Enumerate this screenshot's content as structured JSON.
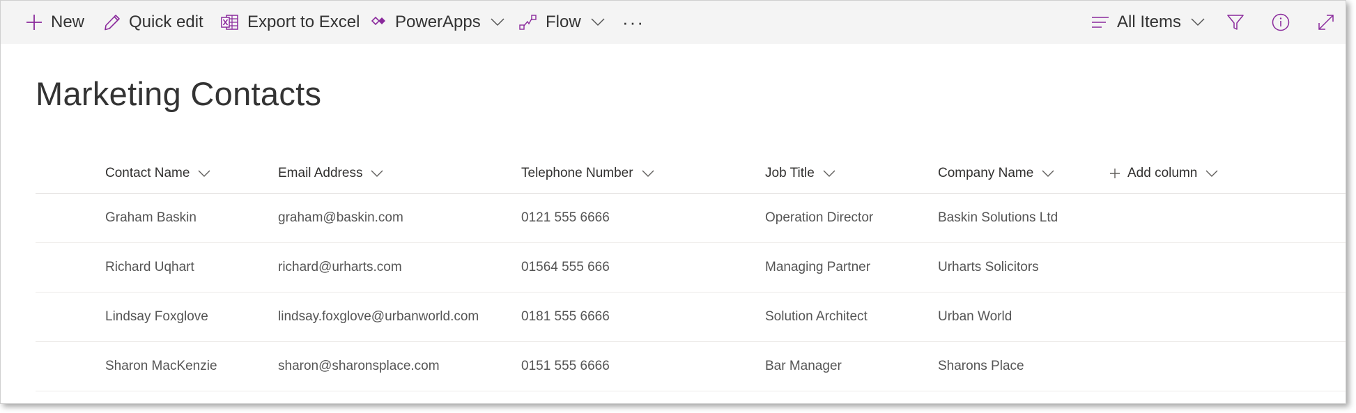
{
  "colors": {
    "accent": "#8a2a9c",
    "toolbar_bg": "#f4f4f4",
    "text": "#333333",
    "cell_text": "#555555",
    "divider": "#edebe9"
  },
  "toolbar": {
    "new_label": "New",
    "new_icon": "plus-icon",
    "quick_edit_label": "Quick edit",
    "quick_edit_icon": "pencil-icon",
    "export_label": "Export to Excel",
    "export_icon": "excel-icon",
    "powerapps_label": "PowerApps",
    "powerapps_icon": "powerapps-icon",
    "flow_label": "Flow",
    "flow_icon": "flow-icon",
    "more_label": "···",
    "view_label": "All Items",
    "view_icon": "view-lines-icon",
    "filter_icon": "filter-icon",
    "info_icon": "info-icon",
    "expand_icon": "expand-icon"
  },
  "list": {
    "title": "Marketing Contacts",
    "columns": [
      "Contact Name",
      "Email Address",
      "Telephone Number",
      "Job Title",
      "Company Name"
    ],
    "add_column_label": "Add column",
    "rows": [
      [
        "Graham Baskin",
        "graham@baskin.com",
        "0121 555 6666",
        "Operation Director",
        "Baskin Solutions Ltd"
      ],
      [
        "Richard Uqhart",
        "richard@urharts.com",
        "01564 555 666",
        "Managing Partner",
        "Urharts Solicitors"
      ],
      [
        "Lindsay Foxglove",
        "lindsay.foxglove@urbanworld.com",
        "0181 555 6666",
        "Solution Architect",
        "Urban World"
      ],
      [
        "Sharon MacKenzie",
        "sharon@sharonsplace.com",
        "0151 555 6666",
        "Bar Manager",
        "Sharons Place"
      ]
    ]
  }
}
